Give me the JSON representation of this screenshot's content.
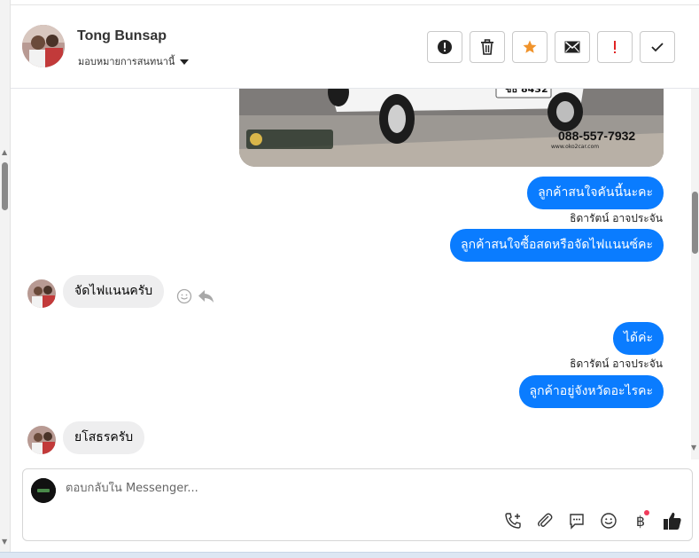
{
  "header": {
    "name": "Tong Bunsap",
    "assign_label": "มอบหมายการสนทนานี้"
  },
  "actions": [
    {
      "name": "report-spam-button",
      "icon": "exclamation-circle-icon"
    },
    {
      "name": "delete-button",
      "icon": "trash-icon"
    },
    {
      "name": "star-button",
      "icon": "star-icon"
    },
    {
      "name": "mark-unread-button",
      "icon": "envelope-icon"
    },
    {
      "name": "mark-important-button",
      "icon": "exclamation-icon"
    },
    {
      "name": "mark-done-button",
      "icon": "checkmark-icon"
    }
  ],
  "image_card": {
    "plate": "ชธ 8432",
    "phone": "088-557-7932",
    "website": "www.oko2car.com"
  },
  "messages": {
    "out1": "ลูกค้าสนใจคันนี้นะคะ",
    "sender1": "ธิดารัตน์ อาจประจัน",
    "out2": "ลูกค้าสนใจซื้อสดหรือจัดไฟแนนซ์คะ",
    "in1": "จัดไฟแนนครับ",
    "out3": "ได้ค่ะ",
    "sender2": "ธิดารัตน์ อาจประจัน",
    "out4": "ลูกค้าอยู่จังหวัดอะไรคะ",
    "in2": "ยโสธรครับ"
  },
  "composer": {
    "placeholder": "ตอบกลับใน Messenger...",
    "baht_symbol": "฿"
  },
  "colors": {
    "outgoing_bubble": "#0a7cff",
    "incoming_bubble": "#eeeeef",
    "star": "#f0932b",
    "important": "#e02424"
  }
}
